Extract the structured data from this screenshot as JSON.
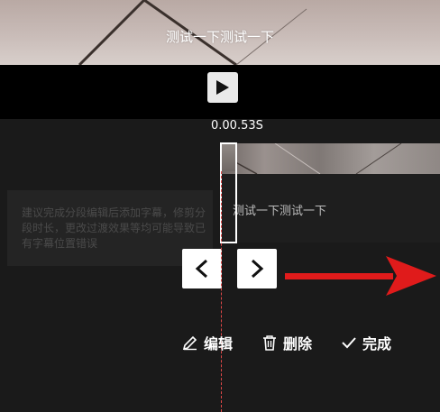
{
  "preview": {
    "subtitle": "测试一下测试一下"
  },
  "player": {
    "play_icon": "play-icon"
  },
  "timeline": {
    "time_readout": "0.00.53S",
    "subtitle_track_text": "测试一下测试一下",
    "hint": "建议完成分段编辑后添加字幕，修剪分段时长，更改过渡效果等均可能导致已有字幕位置错误"
  },
  "actions": {
    "edit_label": "编辑",
    "delete_label": "删除",
    "done_label": "完成"
  },
  "colors": {
    "playhead": "#e04848",
    "annotation_arrow": "#e01b1b",
    "background": "#1a1a1a"
  }
}
